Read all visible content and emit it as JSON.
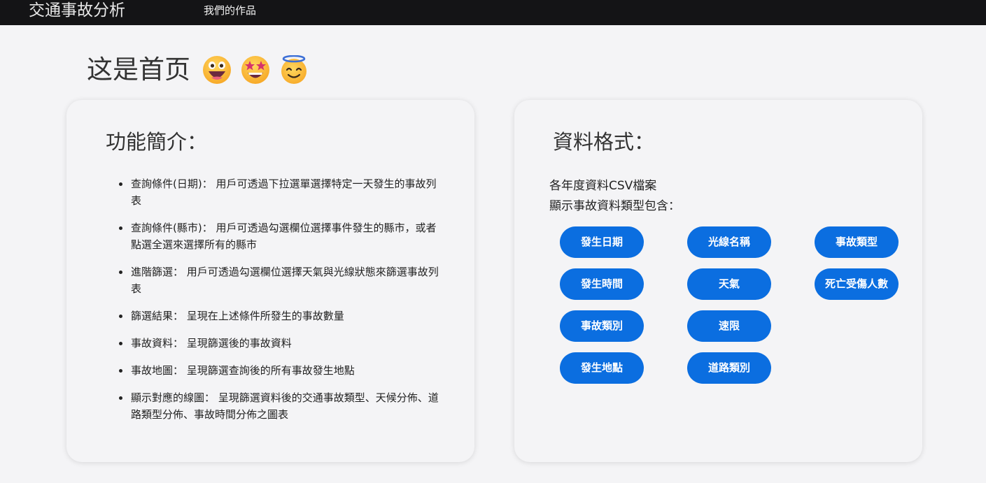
{
  "navbar": {
    "brand": "交通事故分析",
    "links": [
      "我們的作品"
    ]
  },
  "home": {
    "title": "这是首页",
    "emojis": [
      "grinning-face-icon",
      "star-struck-icon",
      "smiling-face-with-halo-icon"
    ]
  },
  "features": {
    "heading": "功能簡介：",
    "items": [
      "查詢條件(日期)： 用戶可透過下拉選單選擇特定一天發生的事故列表",
      "查詢條件(縣市)： 用戶可透過勾選欄位選擇事件發生的縣市，或者點選全選來選擇所有的縣市",
      "進階篩選： 用戶可透過勾選欄位選擇天氣與光線狀態來篩選事故列表",
      "篩選結果： 呈現在上述條件所發生的事故數量",
      "事故資料： 呈現篩選後的事故資料",
      "事故地圖： 呈現篩選查詢後的所有事故發生地點",
      "顯示對應的線圖： 呈現篩選資料後的交通事故類型、天候分佈、道路類型分佈、事故時間分佈之圖表"
    ]
  },
  "data_format": {
    "heading": "資料格式：",
    "line1": "各年度資料CSV檔案",
    "line2": "顯示事故資料類型包含：",
    "fields": [
      "發生日期",
      "光線名稱",
      "事故類型",
      "發生時間",
      "天氣",
      "死亡受傷人數",
      "事故類別",
      "速限",
      "發生地點",
      "道路類別"
    ]
  },
  "colors": {
    "navbar": "#141416",
    "background": "#f4f4f6",
    "pill": "#0b6ee0",
    "pill_text": "#ffffff"
  }
}
